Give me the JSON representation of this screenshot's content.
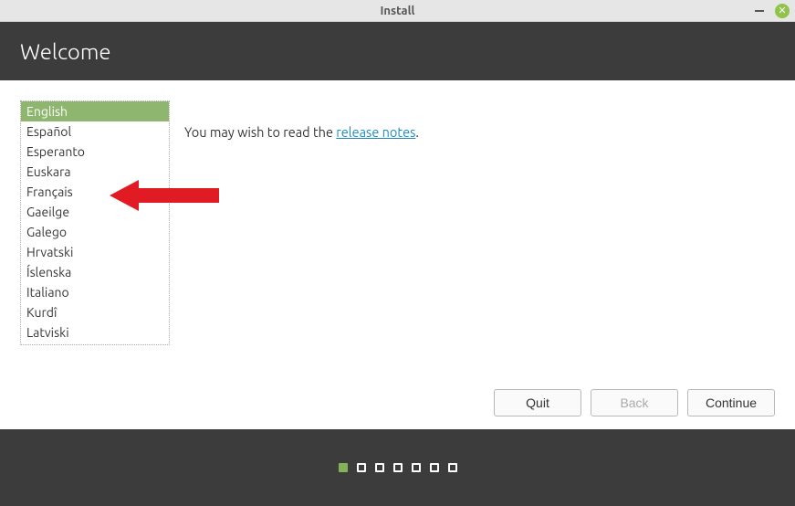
{
  "window": {
    "title": "Install"
  },
  "header": {
    "title": "Welcome"
  },
  "languages": {
    "items": [
      "English",
      "Español",
      "Esperanto",
      "Euskara",
      "Français",
      "Gaeilge",
      "Galego",
      "Hrvatski",
      "Íslenska",
      "Italiano",
      "Kurdî",
      "Latviski"
    ],
    "selected_index": 0
  },
  "info": {
    "prefix": "You may wish to read the ",
    "link_text": "release notes",
    "suffix": "."
  },
  "buttons": {
    "quit": "Quit",
    "back": "Back",
    "continue": "Continue"
  },
  "progress": {
    "total": 7,
    "current": 0
  },
  "colors": {
    "accent": "#8fb66f",
    "header_bg": "#3c3c3c",
    "link": "#1f8ac0",
    "annotation": "#e01b24"
  }
}
